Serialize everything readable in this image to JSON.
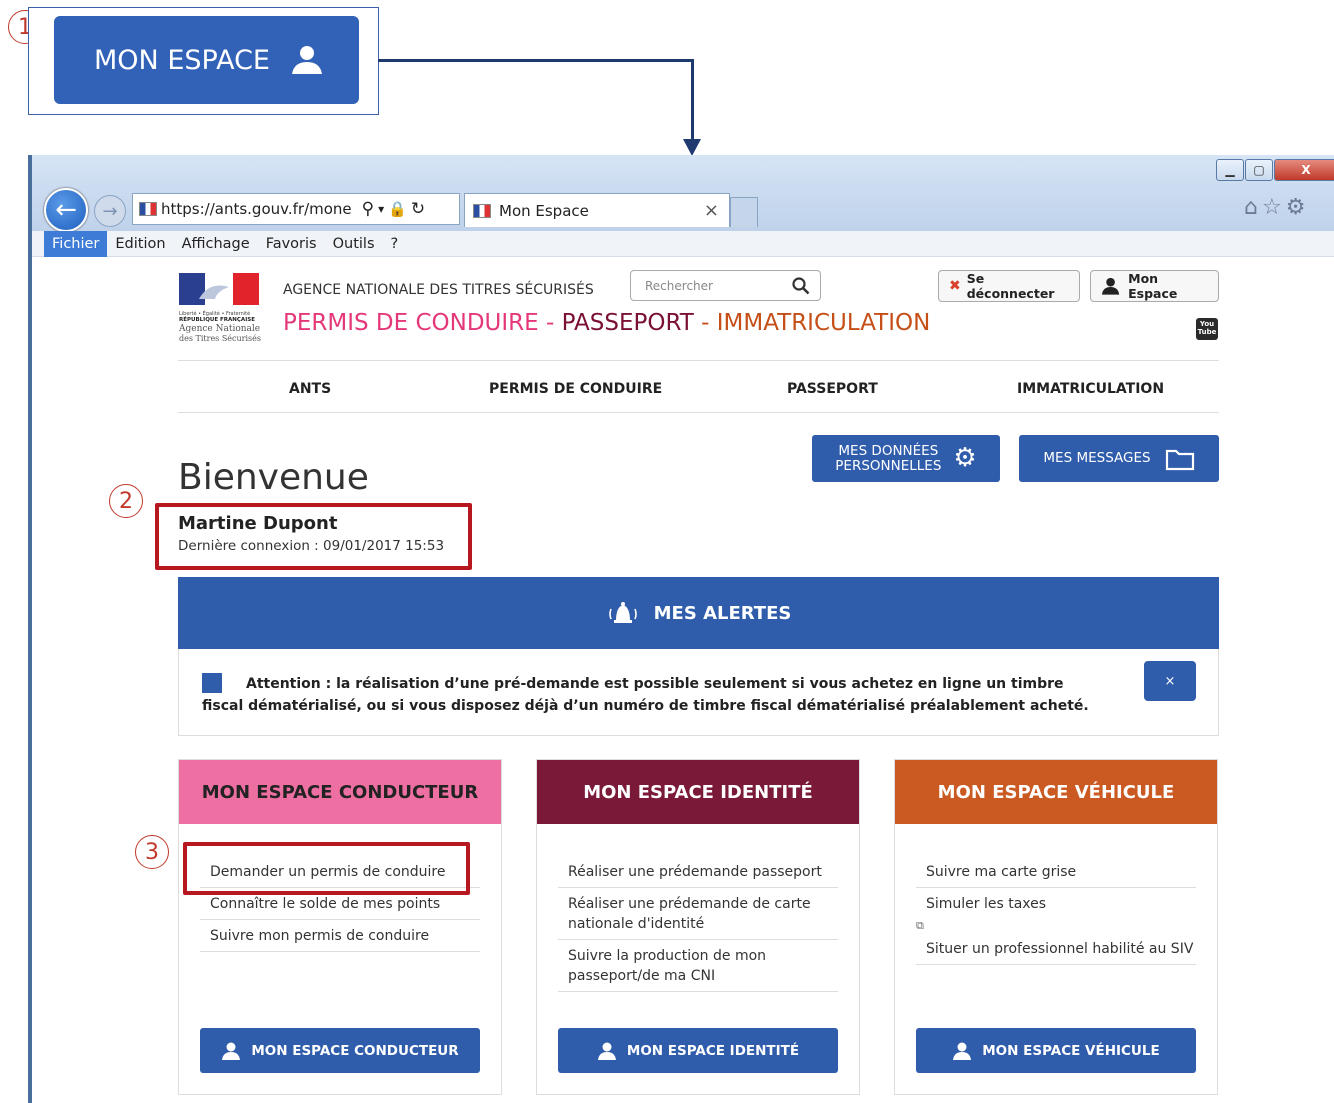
{
  "callouts": {
    "one": "1",
    "two": "2",
    "three": "3"
  },
  "callout_button": {
    "label": "MON ESPACE"
  },
  "browser": {
    "url": "https://ants.gouv.fr/mone",
    "tab_title": "Mon Espace",
    "tab_close": "×",
    "menu": [
      "Fichier",
      "Edition",
      "Affichage",
      "Favoris",
      "Outils",
      "?"
    ]
  },
  "header": {
    "agency": "AGENCE NATIONALE DES TITRES SÉCURISÉS",
    "tagline": {
      "permis": "PERMIS DE CONDUIRE",
      "sep1": " - ",
      "passeport": "PASSEPORT",
      "sep2": " - ",
      "immat": "IMMATRICULATION"
    },
    "search_placeholder": "Rechercher",
    "logout_label": "Se déconnecter",
    "mon_espace_label": "Mon Espace",
    "youtube": "You Tube",
    "logo_text": {
      "line1": "Liberté • Égalité • Fraternité",
      "line2": "RÉPUBLIQUE FRANÇAISE",
      "line3": "Agence Nationale",
      "line4": "des Titres Sécurisés"
    }
  },
  "nav": [
    "ANTS",
    "PERMIS DE CONDUIRE",
    "PASSEPORT",
    "IMMATRICULATION"
  ],
  "top_buttons": {
    "donnees_line1": "MES DONNÉES",
    "donnees_line2": "PERSONNELLES",
    "messages": "MES MESSAGES"
  },
  "welcome": {
    "title": "Bienvenue",
    "name": "Martine Dupont",
    "last_login": "Dernière connexion : 09/01/2017 15:53"
  },
  "alerts": {
    "title": "MES ALERTES",
    "message": "Attention : la réalisation d’une pré-demande est possible seulement si vous achetez en ligne un timbre fiscal dématérialisé, ou si vous disposez déjà d’un numéro de timbre fiscal dématérialisé préalablement acheté.",
    "close": "×"
  },
  "cards": [
    {
      "title": "MON ESPACE CONDUCTEUR",
      "color": "#ee6fa2",
      "title_color": "#222",
      "links": [
        "Demander un permis de conduire",
        "Connaître le solde de mes points",
        "Suivre mon permis de conduire"
      ],
      "button": "MON ESPACE CONDUCTEUR"
    },
    {
      "title": "MON ESPACE IDENTITÉ",
      "color": "#7a1a38",
      "title_color": "#fff",
      "links": [
        "Réaliser une prédemande passeport",
        "Réaliser une prédemande de carte nationale d'identité",
        "Suivre la production de mon passeport/de ma CNI"
      ],
      "button": "MON ESPACE IDENTITÉ"
    },
    {
      "title": "MON ESPACE VÉHICULE",
      "color": "#cb5a22",
      "title_color": "#fff",
      "links": [
        "Suivre ma carte grise",
        "Simuler les taxes",
        "Situer un professionnel habilité au SIV"
      ],
      "button": "MON ESPACE VÉHICULE"
    }
  ]
}
